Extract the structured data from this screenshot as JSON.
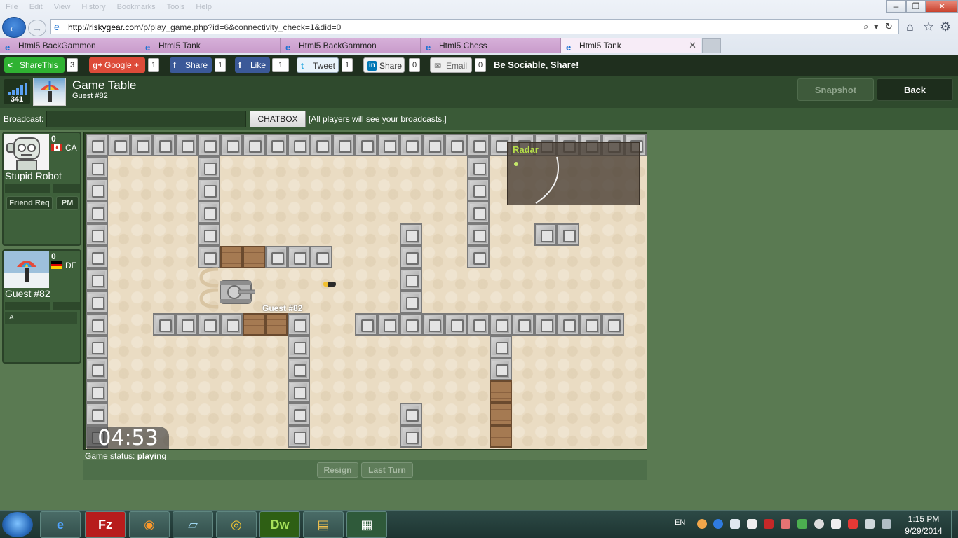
{
  "browser": {
    "menu": [
      "File",
      "Edit",
      "View",
      "History",
      "Bookmarks",
      "Tools",
      "Help"
    ],
    "url_host": "http://riskygear.com",
    "url_path": "/p/play_game.php?id=6&connectivity_check=1&did=0",
    "tabs": [
      {
        "label": "Html5 BackGammon"
      },
      {
        "label": "Html5 Tank"
      },
      {
        "label": "Html5 BackGammon"
      },
      {
        "label": "Html5 Chess"
      },
      {
        "label": "Html5 Tank",
        "active": true
      }
    ]
  },
  "sharebar": {
    "sharethis_label": "ShareThis",
    "sharethis_count": "3",
    "google_label": "Google +",
    "google_count": "1",
    "fb_share_label": "Share",
    "fb_share_count": "1",
    "fb_like_label": "Like",
    "fb_like_count": "1",
    "tweet_label": "Tweet",
    "tweet_count": "1",
    "linkedin_label": "Share",
    "linkedin_count": "0",
    "email_label": "Email",
    "email_count": "0",
    "sociable_text": "Be Sociable, Share!"
  },
  "header": {
    "online_count": "341",
    "title": "Game Table",
    "subtitle": "Guest #82",
    "snapshot_label": "Snapshot",
    "back_label": "Back"
  },
  "broadcast": {
    "label": "Broadcast:",
    "button_label": "CHATBOX",
    "note": "[All players will see your broadcasts.]"
  },
  "players": [
    {
      "name": "Stupid Robot",
      "score": "0",
      "country": "CA",
      "friend_req_label": "Friend Req",
      "pm_label": "PM"
    },
    {
      "name": "Guest #82",
      "score": "0",
      "country": "DE",
      "chat_text": "A"
    }
  ],
  "game": {
    "radar_title": "Radar",
    "tank_label": "Guest #82",
    "timer": "04:53",
    "status_label": "Game status:",
    "status_value": "playing",
    "resign_label": "Resign",
    "last_turn_label": "Last Turn"
  },
  "taskbar": {
    "apps": [
      "internet-explorer",
      "filezilla",
      "firefox",
      "notepad",
      "chrome",
      "dreamweaver",
      "file-explorer",
      "camtasia"
    ],
    "lang": "EN",
    "time": "1:15 PM",
    "date": "9/29/2014"
  },
  "colors": {
    "page_bg": "#5a7a52",
    "header_bg": "#2f4a2d",
    "sharebar_bg": "#1f2f1e",
    "sand": "#eadcc3",
    "radar_text": "#b6df4a"
  }
}
